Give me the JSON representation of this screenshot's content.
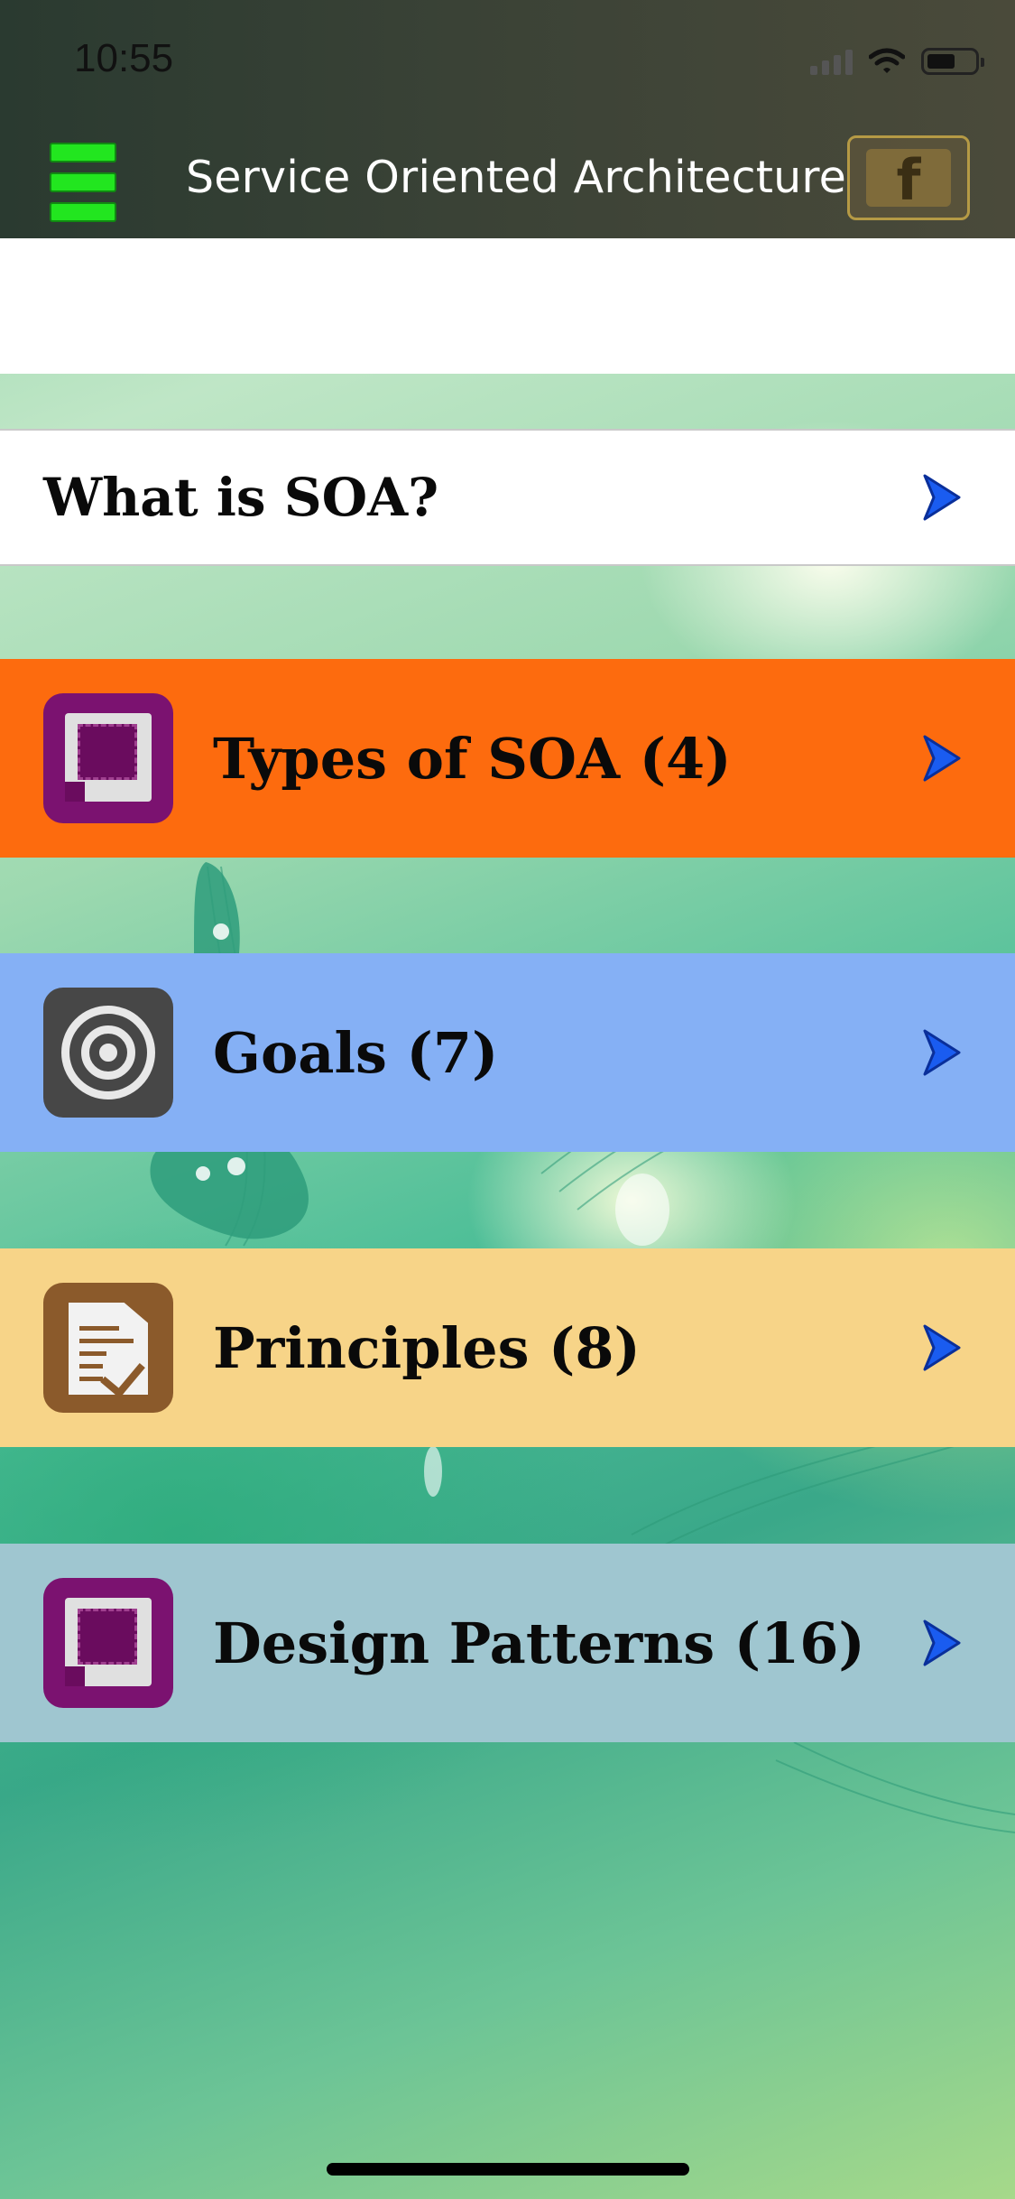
{
  "status_bar": {
    "time": "10:55"
  },
  "header": {
    "title": "Service Oriented Architecture",
    "menu_icon": "hamburger-menu-icon",
    "share_icon": "facebook-icon",
    "share_glyph": "f"
  },
  "intro_item": {
    "label": "What is SOA?"
  },
  "menu_items": [
    {
      "label": "Types of SOA (4)",
      "icon": "frame-icon",
      "color": "#fd6b0e"
    },
    {
      "label": "Goals (7)",
      "icon": "target-icon",
      "color": "#85b0f5"
    },
    {
      "label": "Principles (8)",
      "icon": "document-check-icon",
      "color": "#f7d488"
    },
    {
      "label": "Design Patterns (16)",
      "icon": "frame-icon",
      "color": "#9fc6d0"
    }
  ],
  "colors": {
    "menu_accent": "#22e61f",
    "chevron": "#1a5cf0"
  }
}
